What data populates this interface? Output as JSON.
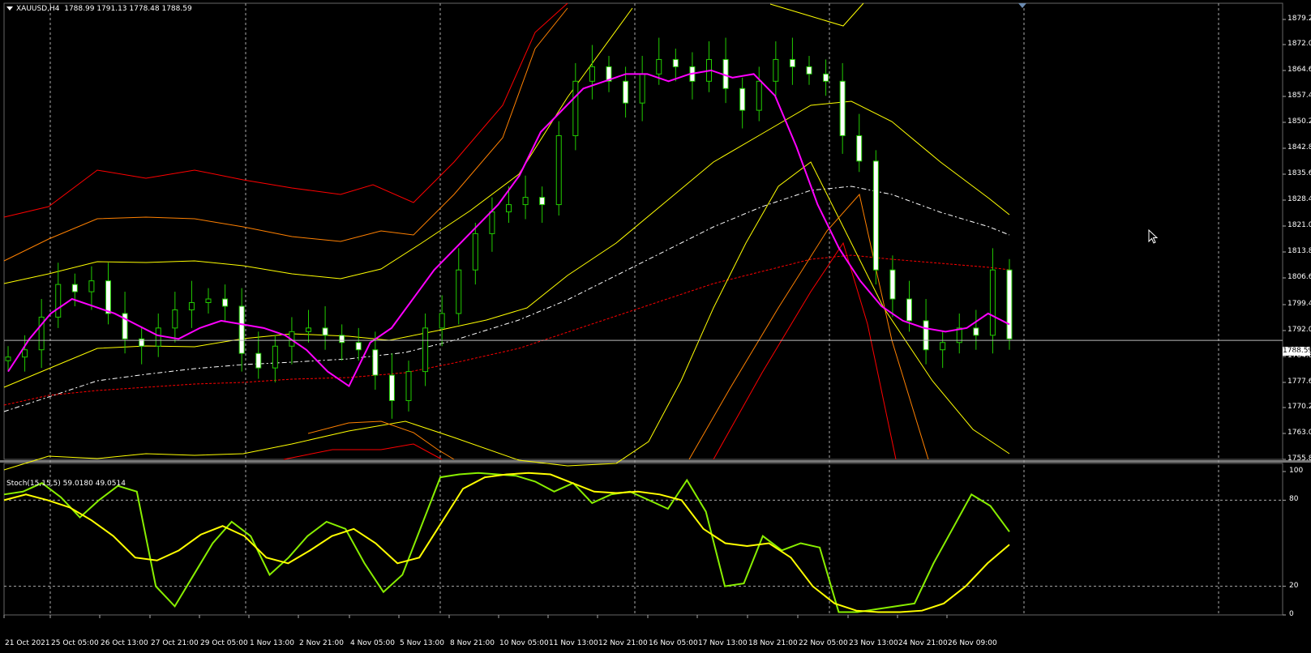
{
  "header": {
    "symbol": "XAUUSD,H4",
    "ohlc": "1788.99 1791.13 1778.48 1788.59"
  },
  "price_panel": {
    "current_price": "1788.59",
    "y_ticks": [
      "1879.20",
      "1872.00",
      "1864.60",
      "1857.40",
      "1850.20",
      "1842.80",
      "1835.60",
      "1828.40",
      "1821.00",
      "1813.80",
      "1806.60",
      "1799.40",
      "1792.00",
      "1784.80",
      "1777.60",
      "1770.20",
      "1763.00",
      "1755.80"
    ]
  },
  "stoch_panel": {
    "title": "Stoch(15,15,5) 59.0180 49.0514",
    "y_ticks": [
      "100",
      "80",
      "20",
      "0"
    ]
  },
  "x_ticks": [
    "21 Oct 2021",
    "25 Oct 05:00",
    "26 Oct 13:00",
    "27 Oct 21:00",
    "29 Oct 05:00",
    "1 Nov 13:00",
    "2 Nov 21:00",
    "4 Nov 05:00",
    "5 Nov 13:00",
    "8 Nov 21:00",
    "10 Nov 05:00",
    "11 Nov 13:00",
    "12 Nov 21:00",
    "16 Nov 05:00",
    "17 Nov 13:00",
    "18 Nov 21:00",
    "22 Nov 05:00",
    "23 Nov 13:00",
    "24 Nov 21:00",
    "26 Nov 09:00"
  ],
  "colors": {
    "background": "#000000",
    "candle": "#22cc00",
    "candle_body": "#ffffff",
    "ma": "#ff00ff",
    "env_yellow": "#ffff00",
    "env_orange": "#ff8000",
    "env_red": "#ff0000",
    "stoch_main": "#88ee00",
    "stoch_signal": "#ffff00"
  },
  "chart_data": [
    {
      "type": "candlestick",
      "title": "XAUUSD,H4",
      "ylim": [
        1755.8,
        1881.5
      ],
      "x_categories": [
        "21 Oct 2021",
        "25 Oct 05:00",
        "26 Oct 13:00",
        "27 Oct 21:00",
        "29 Oct 05:00",
        "1 Nov 13:00",
        "2 Nov 21:00",
        "4 Nov 05:00",
        "5 Nov 13:00",
        "8 Nov 21:00",
        "10 Nov 05:00",
        "11 Nov 13:00",
        "12 Nov 21:00",
        "16 Nov 05:00",
        "17 Nov 13:00",
        "18 Nov 21:00",
        "22 Nov 05:00",
        "23 Nov 13:00",
        "24 Nov 21:00",
        "26 Nov 09:00"
      ],
      "close_path": [
        1784,
        1786,
        1795,
        1804,
        1802,
        1805,
        1796,
        1789,
        1787,
        1792,
        1797,
        1799,
        1800,
        1798,
        1785,
        1781,
        1787,
        1791,
        1792,
        1790,
        1788,
        1786,
        1779,
        1772,
        1780,
        1792,
        1796,
        1808,
        1818,
        1824,
        1826,
        1828,
        1826,
        1845,
        1860,
        1864,
        1860,
        1854,
        1862,
        1866,
        1864,
        1860,
        1866,
        1858,
        1852,
        1860,
        1866,
        1864,
        1862,
        1860,
        1845,
        1838,
        1808,
        1800,
        1794,
        1786,
        1788,
        1792,
        1790,
        1808,
        1789
      ],
      "ma_path": [
        1780,
        1789,
        1796,
        1800,
        1798,
        1796,
        1793,
        1790,
        1789,
        1792,
        1794,
        1793,
        1792,
        1790,
        1786,
        1780,
        1776,
        1788,
        1792,
        1800,
        1808,
        1814,
        1820,
        1826,
        1834,
        1846,
        1852,
        1858,
        1860,
        1862,
        1862,
        1860,
        1862,
        1863,
        1861,
        1862,
        1856,
        1842,
        1826,
        1814,
        1805,
        1798,
        1794,
        1792,
        1791,
        1792,
        1796,
        1793
      ],
      "stoch_path": [
        84,
        86,
        92,
        82,
        68,
        80,
        90,
        86,
        20,
        6,
        28,
        50,
        65,
        55,
        28,
        40,
        55,
        65,
        60,
        36,
        16,
        28,
        62,
        96,
        98,
        99,
        98,
        97,
        93,
        86,
        92,
        78,
        84,
        86,
        80,
        74,
        94,
        72,
        20,
        22,
        55,
        45,
        50,
        47,
        2,
        2,
        4,
        6,
        8,
        36,
        60,
        84,
        76,
        58
      ],
      "stoch_signal_path": [
        80,
        84,
        80,
        75,
        66,
        55,
        40,
        38,
        45,
        56,
        62,
        55,
        40,
        36,
        45,
        55,
        60,
        50,
        36,
        40,
        64,
        88,
        96,
        98,
        99,
        98,
        92,
        86,
        85,
        86,
        84,
        80,
        60,
        50,
        48,
        50,
        40,
        20,
        8,
        3,
        2,
        2,
        3,
        8,
        20,
        36,
        49
      ]
    }
  ]
}
